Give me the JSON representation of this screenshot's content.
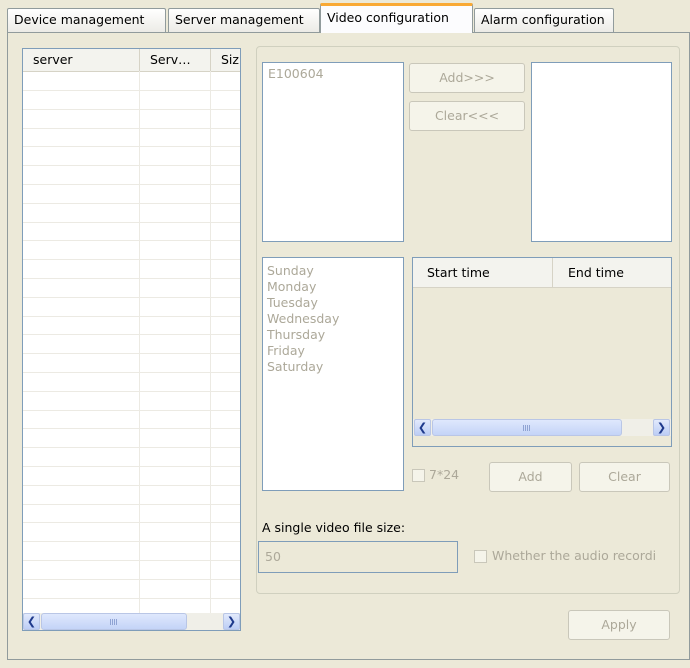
{
  "tabs": [
    {
      "label": "Device management",
      "active": false
    },
    {
      "label": "Server management",
      "active": false
    },
    {
      "label": "Video configuration",
      "active": true
    },
    {
      "label": "Alarm configuration",
      "active": false
    }
  ],
  "server_table": {
    "columns": [
      "server",
      "Serv…",
      "Siz"
    ],
    "rows": []
  },
  "device_list": {
    "items": [
      "E100604"
    ]
  },
  "buttons": {
    "add": "Add>>>",
    "clear": "Clear<<<",
    "time_add": "Add",
    "time_clear": "Clear",
    "apply": "Apply"
  },
  "days": [
    "Sunday",
    "Monday",
    "Tuesday",
    "Wednesday",
    "Thursday",
    "Friday",
    "Saturday"
  ],
  "time_table": {
    "columns": [
      "Start time",
      "End time"
    ],
    "rows": []
  },
  "checkbox_724": {
    "label": "7*24",
    "checked": false
  },
  "file_size": {
    "label": "A single video file size:",
    "value": "50"
  },
  "audio_checkbox": {
    "label": "Whether the audio recordi",
    "checked": false
  },
  "scrollbar_grip": "IIII",
  "colors": {
    "active_tab_accent": "#f9a934",
    "field_border": "#7f9db9",
    "disabled_text": "#aca899"
  }
}
